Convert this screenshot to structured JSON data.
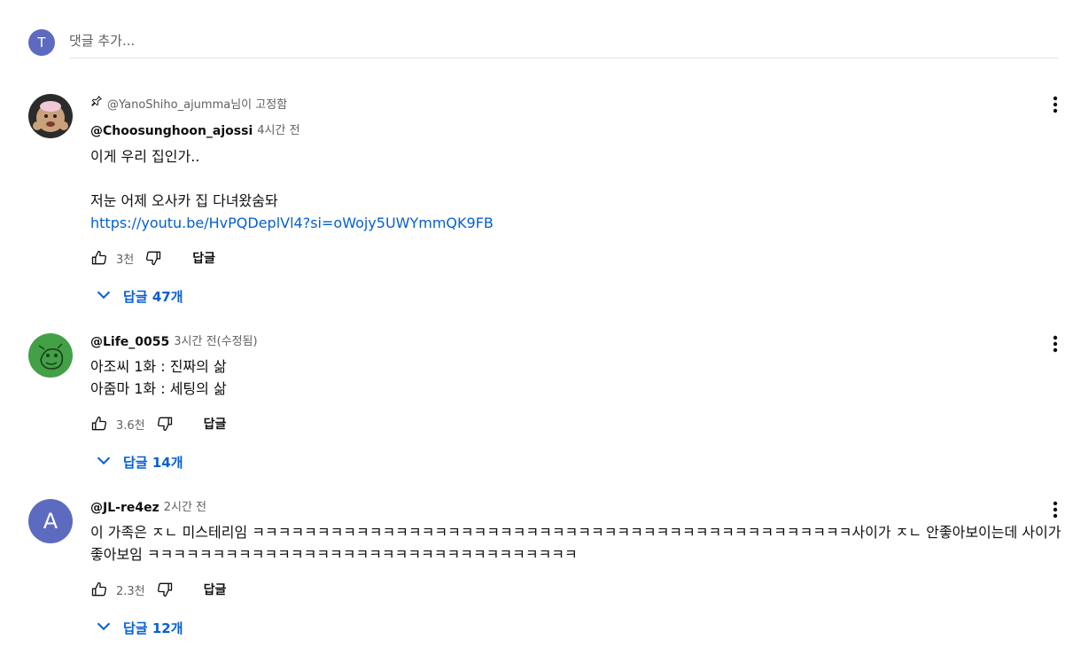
{
  "add_comment": {
    "avatar_initial": "T",
    "placeholder": "댓글 추가..."
  },
  "comments": [
    {
      "pinned_by": "@YanoShiho_ajumma님이 고정함",
      "author": "@Choosunghoon_ajossi",
      "time": "4시간 전",
      "lines": [
        "이게 우리 집인가..",
        "",
        "저눈 어제 오사카 집 다녀왔숨돠"
      ],
      "link": "https://youtu.be/HvPQDeplVl4?si=oWojy5UWYmmQK9FB",
      "likes": "3천",
      "reply_label": "답글",
      "replies_label": "답글 47개"
    },
    {
      "author": "@Life_0055",
      "time": "3시간 전(수정됨)",
      "lines": [
        "아조씨 1화 : 진짜의 삶",
        "아줌마 1화 : 세팅의 삶"
      ],
      "likes": "3.6천",
      "reply_label": "답글",
      "replies_label": "답글 14개"
    },
    {
      "avatar_initial": "A",
      "author": "@JL-re4ez",
      "time": "2시간 전",
      "lines": [
        "이 가족은 ㅈㄴ 미스테리임 ㅋㅋㅋㅋㅋㅋㅋㅋㅋㅋㅋㅋㅋㅋㅋㅋㅋㅋㅋㅋㅋㅋㅋㅋㅋㅋㅋㅋㅋㅋㅋㅋㅋㅋㅋㅋㅋㅋㅋㅋㅋㅋㅋㅋㅋㅋ사이가 ㅈㄴ 안좋아보이는데 사이가 좋아보임 ㅋㅋㅋㅋㅋㅋㅋㅋㅋㅋㅋㅋㅋㅋㅋㅋㅋㅋㅋㅋㅋㅋㅋㅋㅋㅋㅋㅋㅋㅋㅋㅋㅋ"
      ],
      "likes": "2.3천",
      "reply_label": "답글",
      "replies_label": "답글 12개"
    }
  ],
  "colors": {
    "link": "#065fd4",
    "avatar_a": "#5c6bc0",
    "avatar_green": "#43a047"
  },
  "icons": [
    "pin-icon",
    "thumbs-up-icon",
    "thumbs-down-icon",
    "chevron-down-icon",
    "more-vert-icon"
  ]
}
